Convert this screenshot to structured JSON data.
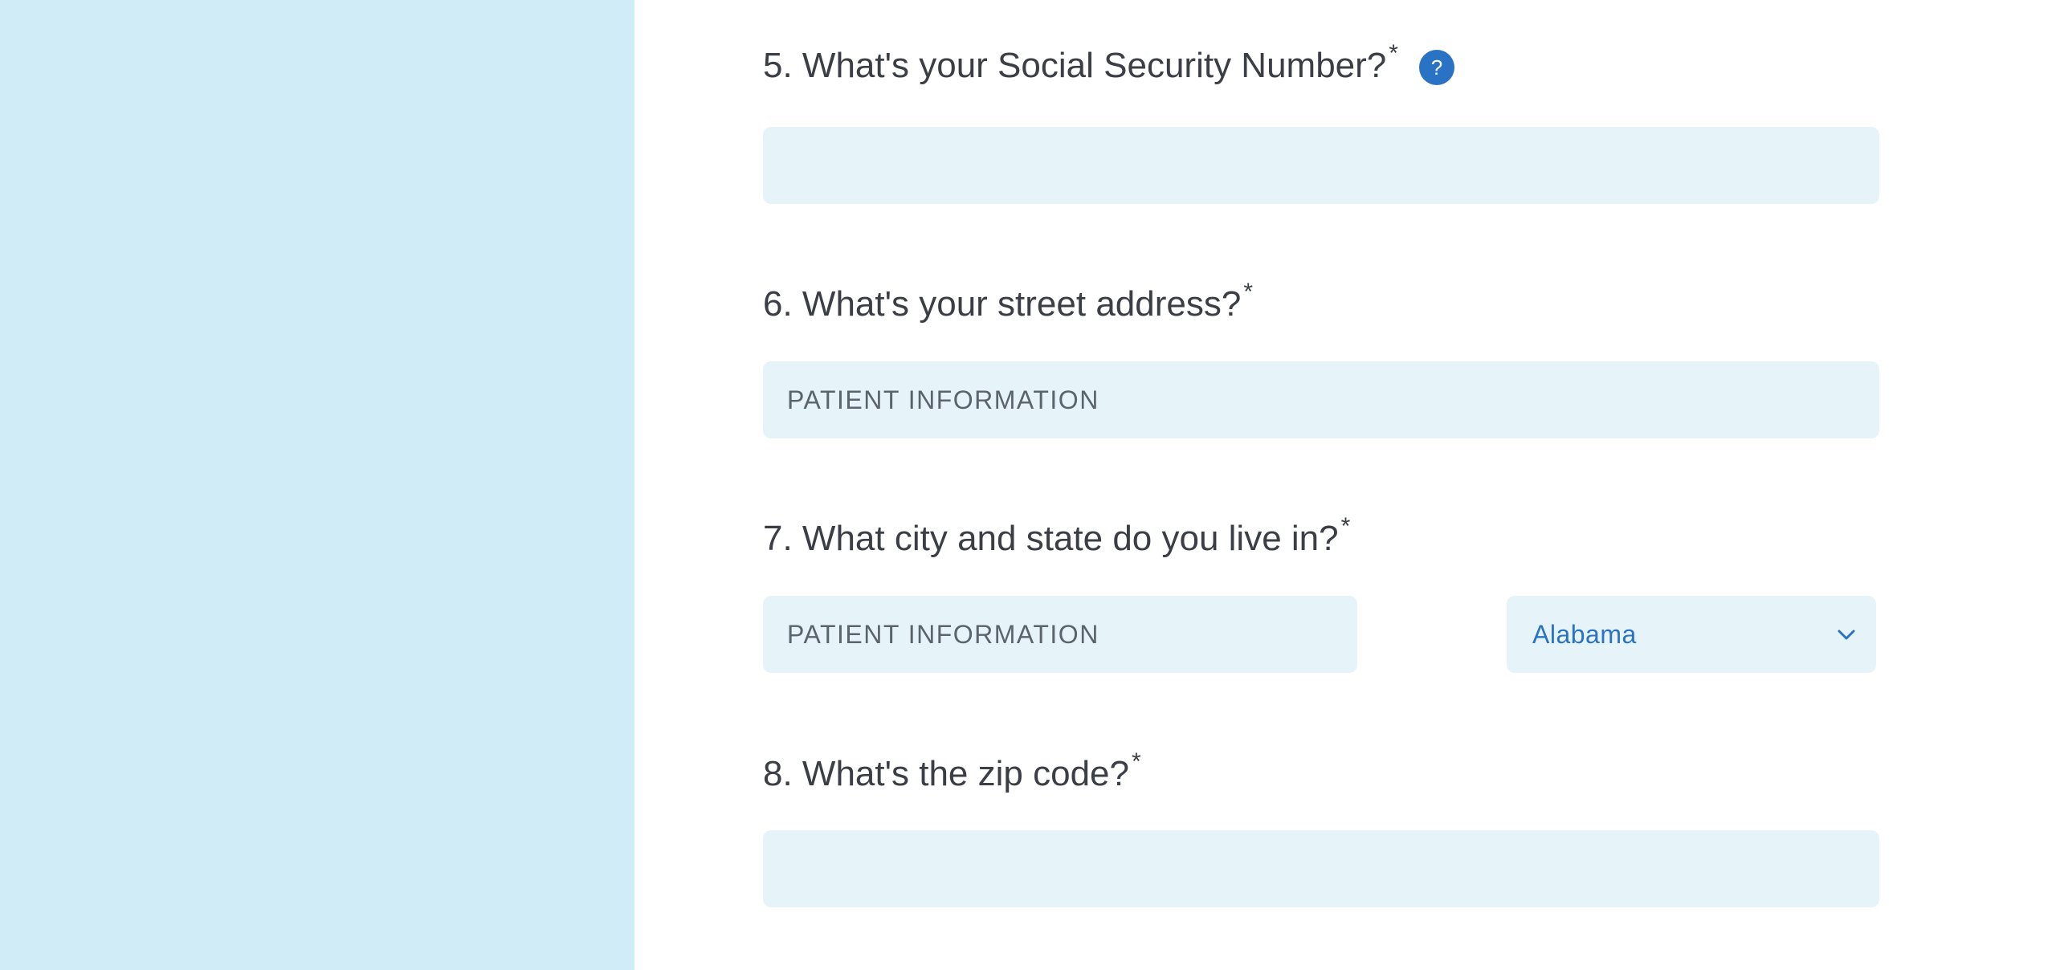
{
  "questions": [
    {
      "label": "5. What's your Social Security Number?",
      "required_mark": "*",
      "help_icon_text": "?",
      "input_value": "",
      "input_placeholder": ""
    },
    {
      "label": "6. What's your street address?",
      "required_mark": "*",
      "input_value": "",
      "input_placeholder": "PATIENT INFORMATION"
    },
    {
      "label": "7. What city and state do you live in?",
      "required_mark": "*",
      "city_value": "",
      "city_placeholder": "PATIENT INFORMATION",
      "state_value": "Alabama"
    },
    {
      "label": "8. What's the zip code?",
      "required_mark": "*",
      "input_value": "",
      "input_placeholder": ""
    }
  ],
  "colors": {
    "sidebar_bg": "#cfecf7",
    "field_bg": "#e6f4fa",
    "accent": "#2a73c4",
    "text": "#3b3f45"
  },
  "icons": {
    "help": "help-icon",
    "select_arrow": "chevron-down-icon"
  }
}
